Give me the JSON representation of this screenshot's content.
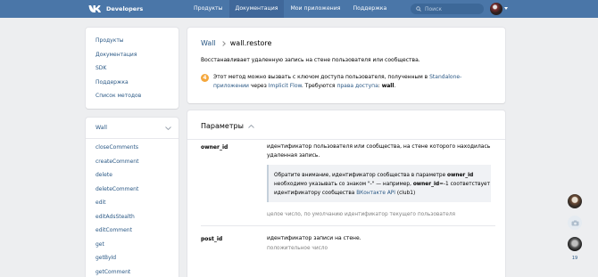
{
  "header": {
    "brand": "Developers",
    "nav": [
      "Продукты",
      "Документация",
      "Мои приложения",
      "Поддержка"
    ],
    "active_nav_index": 1,
    "search_placeholder": "Поиск",
    "bar_color": "#4a76a8"
  },
  "sidebar": {
    "links": [
      "Продукты",
      "Документация",
      "SDK",
      "Поддержка",
      "Список методов"
    ],
    "section_title": "Wall",
    "methods": [
      "closeComments",
      "createComment",
      "delete",
      "deleteComment",
      "edit",
      "editAdsStealth",
      "editComment",
      "get",
      "getById",
      "getComment"
    ]
  },
  "page": {
    "breadcrumb_parent": "Wall",
    "breadcrumb_current": "wall.restore",
    "description": "Восстанавливает удаленную запись на стене пользователя или сообщества.",
    "notice": {
      "icon_text": "4",
      "part1": "Этот метод можно вызвать с ключом доступа пользователя, полученным в ",
      "link1": "Standalone-приложении",
      "part2": " через ",
      "link2": "Implicit Flow",
      "part3": ". Требуются ",
      "link3": "права доступа",
      "part4": ": ",
      "bold": "wall",
      "part5": "."
    }
  },
  "params": {
    "title": "Параметры",
    "owner_id": {
      "name": "owner_id",
      "desc": "идентификатор пользователя или сообщества, на стене которого находилась удаленная запись.",
      "callout_part1": "Обратите внимание, идентификатор сообщества в параметре ",
      "callout_bold1": "owner_id",
      "callout_part2": " необходимо указывать со знаком \"-\" — например, ",
      "callout_bold2": "owner_id",
      "callout_part3": "=-1 соответствует идентификатору сообщества ",
      "callout_link": "ВКонтакте API",
      "callout_part4": " (club1)",
      "type": "целое число, по умолчанию идентификатор текущего пользователя"
    },
    "post_id": {
      "name": "post_id",
      "desc": "идентификатор записи на стене.",
      "type": "положительное число"
    }
  },
  "rail": {
    "count": "19"
  }
}
